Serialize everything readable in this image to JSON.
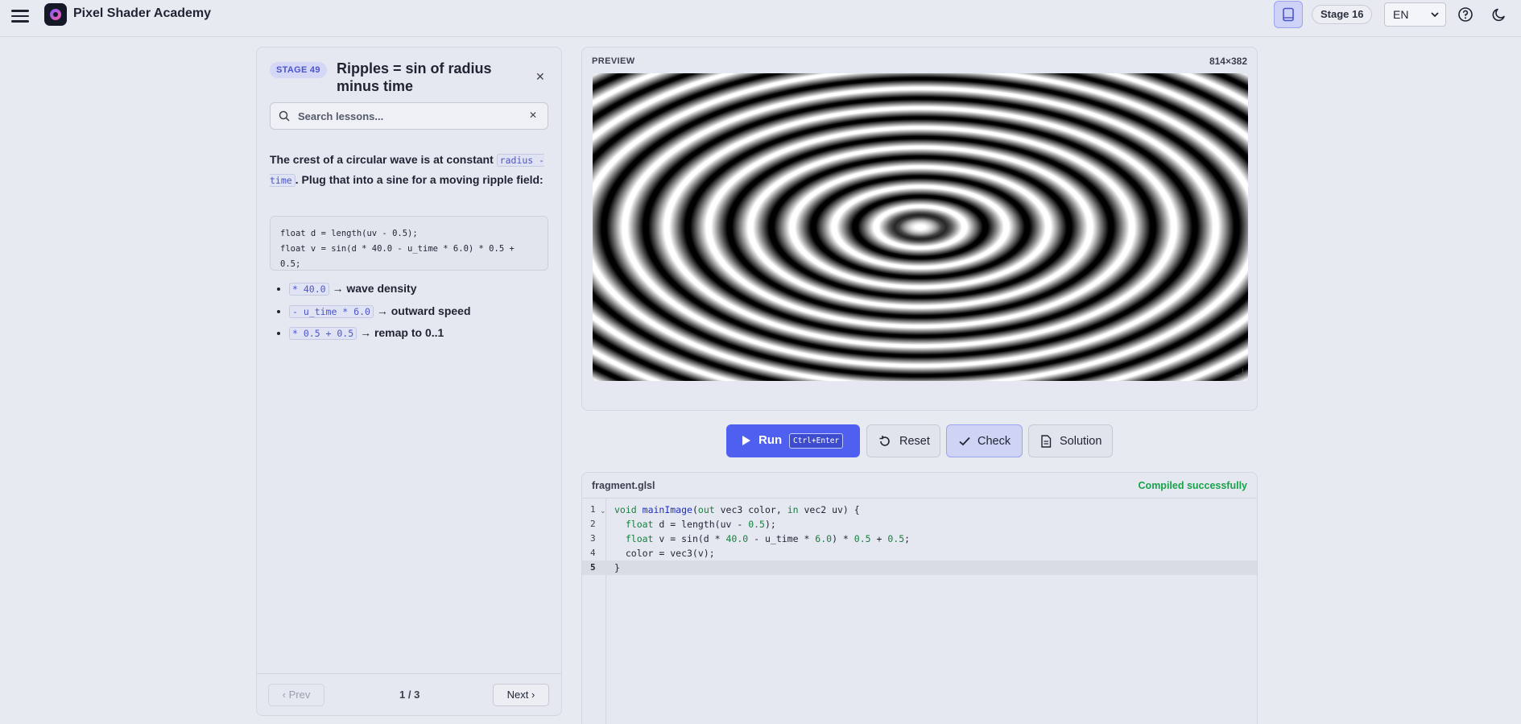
{
  "app": {
    "title": "Pixel Shader Academy"
  },
  "header": {
    "stage_label": "Stage 16",
    "language": "EN"
  },
  "lesson": {
    "stage_badge": "STAGE 49",
    "title": "Ripples = sin of radius minus time",
    "search_placeholder": "Search lessons...",
    "intro_pre": "The crest of a circular wave is at constant ",
    "intro_code": "radius - time",
    "intro_post": ". Plug that into a sine for a moving ripple field:",
    "code_lines": [
      "float d = length(uv - 0.5);",
      "float v = sin(d * 40.0 - u_time * 6.0) * 0.5 + 0.5;"
    ],
    "bullets": [
      {
        "code": "* 40.0",
        "text": "→ wave density"
      },
      {
        "code": "- u_time * 6.0",
        "text": "→ outward speed"
      },
      {
        "code": "* 0.5 + 0.5",
        "text": "→ remap to 0..1"
      }
    ],
    "pagination": {
      "prev": "Prev",
      "next": "Next",
      "indicator": "1 / 3"
    }
  },
  "preview": {
    "label": "PREVIEW",
    "size": "814×382"
  },
  "actions": {
    "run": "Run",
    "run_shortcut": "Ctrl+Enter",
    "reset": "Reset",
    "check": "Check",
    "solution": "Solution"
  },
  "editor": {
    "file_name": "fragment.glsl",
    "status": "Compiled successfully",
    "line_numbers": [
      "1",
      "2",
      "3",
      "4",
      "5"
    ]
  },
  "colors": {
    "accent": "#4f5ff0",
    "success": "#16a34a",
    "badge_text": "#4b55c9"
  }
}
